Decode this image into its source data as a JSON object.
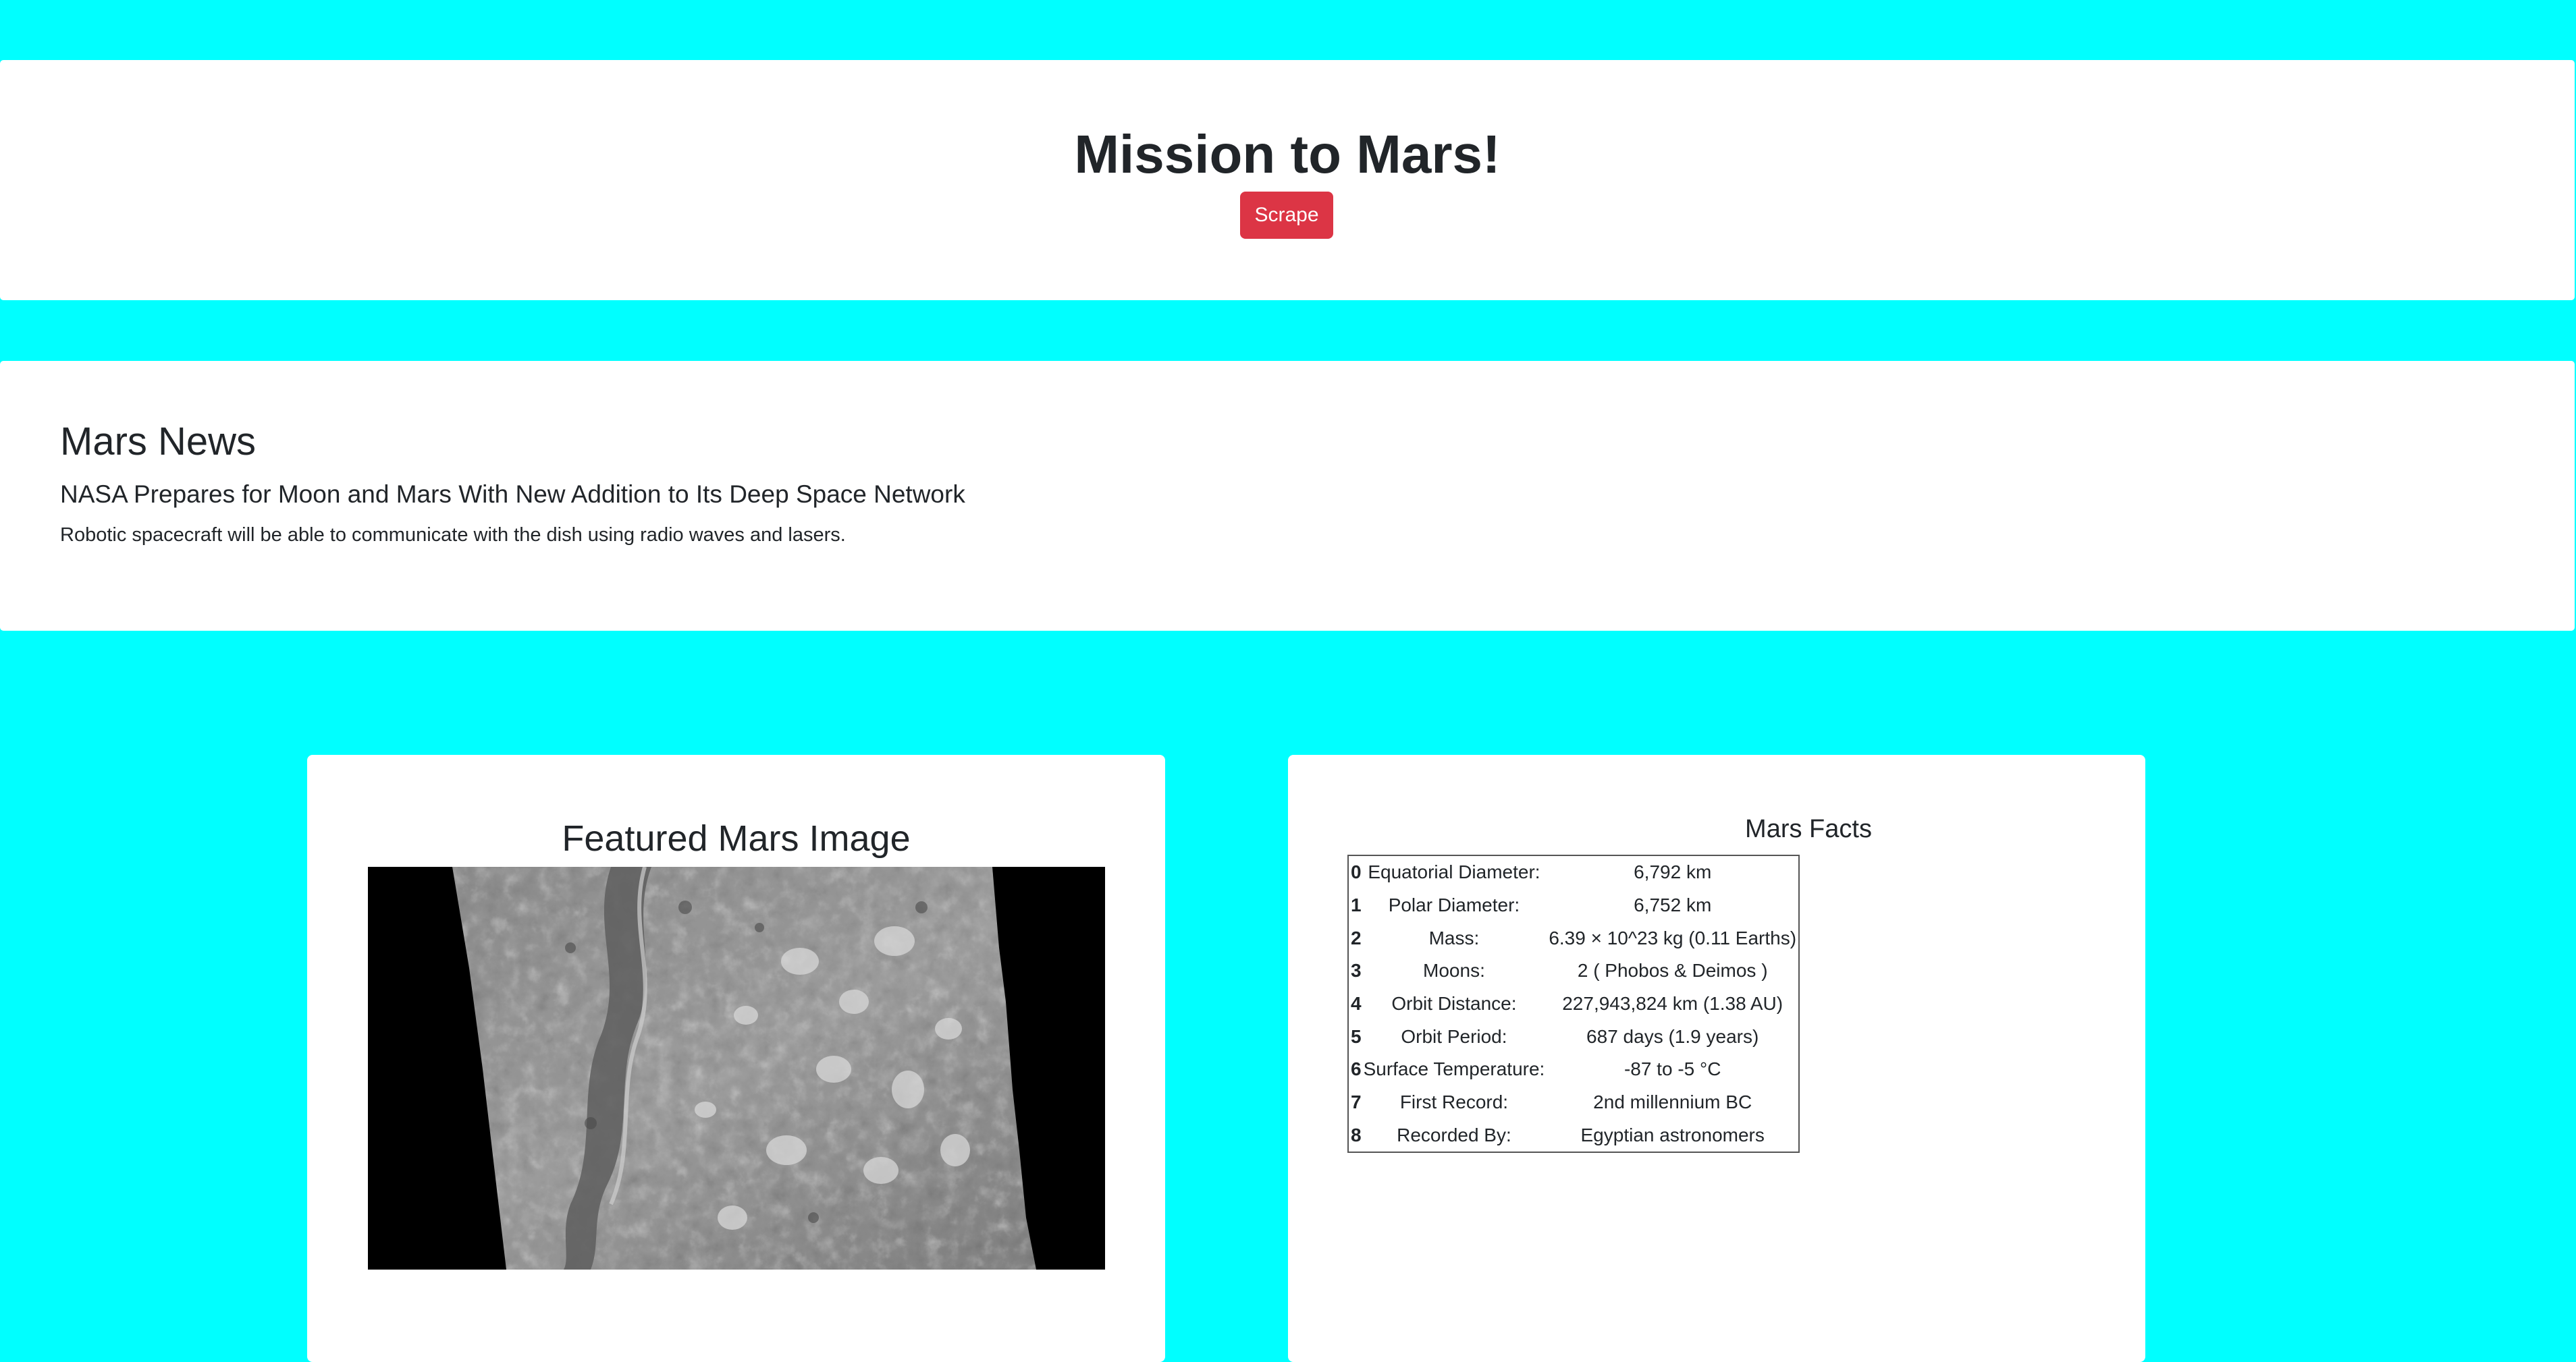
{
  "header": {
    "title": "Mission to Mars!",
    "scrape_label": "Scrape"
  },
  "news": {
    "heading": "Mars News",
    "title": "NASA Prepares for Moon and Mars With New Addition to Its Deep Space Network",
    "paragraph": "Robotic spacecraft will be able to communicate with the dish using radio waves and lasers."
  },
  "featured_image": {
    "heading": "Featured Mars Image"
  },
  "facts": {
    "heading": "Mars Facts",
    "rows": [
      {
        "index": "0",
        "label": "Equatorial Diameter:",
        "value": "6,792 km"
      },
      {
        "index": "1",
        "label": "Polar Diameter:",
        "value": "6,752 km"
      },
      {
        "index": "2",
        "label": "Mass:",
        "value": "6.39 × 10^23 kg (0.11 Earths)"
      },
      {
        "index": "3",
        "label": "Moons:",
        "value": "2 ( Phobos & Deimos )"
      },
      {
        "index": "4",
        "label": "Orbit Distance:",
        "value": "227,943,824 km (1.38 AU)"
      },
      {
        "index": "5",
        "label": "Orbit Period:",
        "value": "687 days (1.9 years)"
      },
      {
        "index": "6",
        "label": "Surface Temperature:",
        "value": "-87 to -5 °C"
      },
      {
        "index": "7",
        "label": "First Record:",
        "value": "2nd millennium BC"
      },
      {
        "index": "8",
        "label": "Recorded By:",
        "value": "Egyptian astronomers"
      }
    ]
  },
  "colors": {
    "page_background": "#00ffff",
    "button": "#dc3545"
  }
}
